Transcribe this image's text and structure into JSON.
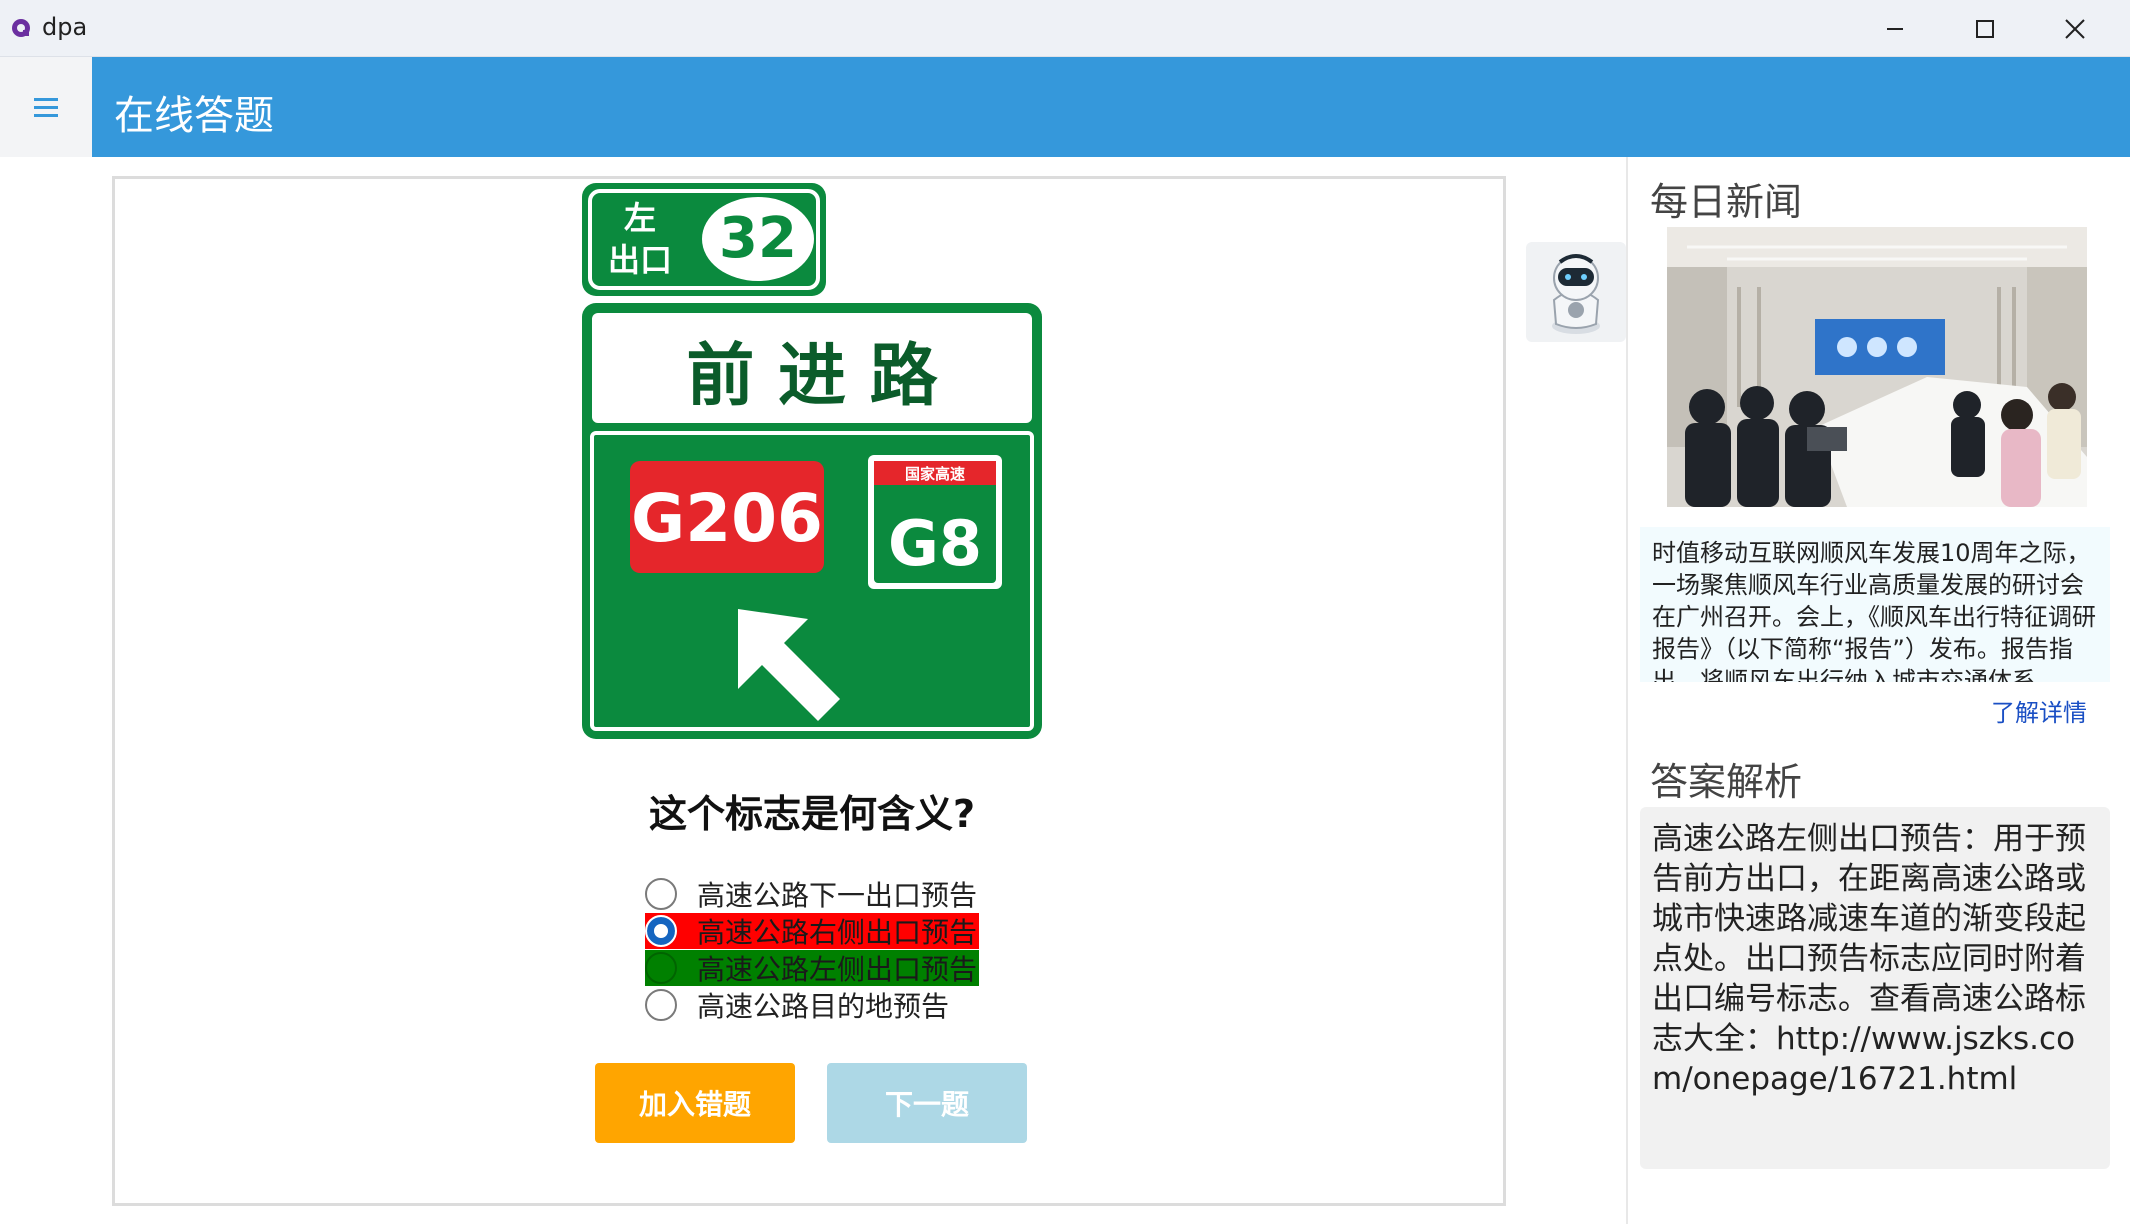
{
  "window": {
    "app_name": "dpa",
    "accent": "#3598db"
  },
  "header": {
    "title": "在线答题"
  },
  "quiz": {
    "sign": {
      "exit_side_line1": "左",
      "exit_side_line2": "出口",
      "exit_number": "32",
      "road_name": "前 进 路",
      "route_national": "G206",
      "route_expressway": "G8",
      "expressway_tag": "国家高速"
    },
    "question": "这个标志是何含义?",
    "options": [
      {
        "label": "高速公路下一出口预告",
        "state": "none"
      },
      {
        "label": "高速公路右侧出口预告",
        "state": "selected-wrong",
        "color": "#ff0000"
      },
      {
        "label": "高速公路左侧出口预告",
        "state": "correct",
        "color": "#008000"
      },
      {
        "label": "高速公路目的地预告",
        "state": "none"
      }
    ],
    "buttons": {
      "add_wrong": "加入错题",
      "next": "下一题"
    }
  },
  "sidebar": {
    "news_title": "每日新闻",
    "news_text": "时值移动互联网顺风车发展10周年之际，一场聚焦顺风车行业高质量发展的研讨会在广州召开。会上，《顺风车出行特征调研报告》（以下简称“报告”）发布。报告指出，将顺风车出行纳入城市交通体系",
    "more_link": "了解详情",
    "analysis_title": "答案解析",
    "analysis_text": "高速公路左侧出口预告：用于预告前方出口，在距离高速公路或城市快速路减速车道的渐变段起点处。出口预告标志应同时附着出口编号标志。查看高速公路标志大全：http://www.jszks.com/onepage/16721.html"
  }
}
